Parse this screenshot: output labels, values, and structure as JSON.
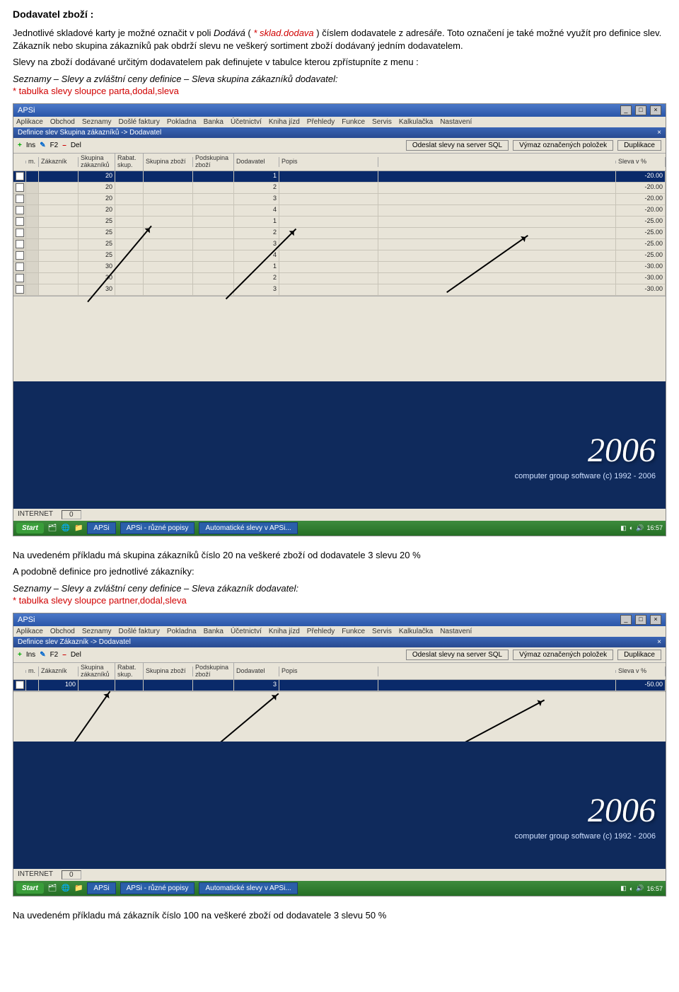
{
  "doc": {
    "heading": "Dodavatel zboží :",
    "p1a": "Jednotlivé skladové karty je možné označit v poli ",
    "p1_field": "Dodává",
    "p1b": " ( ",
    "p1_var": "* sklad.dodava",
    "p1c": ") číslem dodavatele z adresáře. Toto označení je také možné využít pro definice slev. Zákazník nebo skupina zákazníků pak obdrží slevu ne veškerý sortiment zboží dodávaný jedním dodavatelem.",
    "p2": "Slevy na zboží dodávané určitým dodavatelem pak definujete v tabulce kterou zpřístupníte z menu :",
    "p3": "Seznamy – Slevy a zvláštní ceny definice – Sleva  skupina zákazníků  dodavatel:",
    "p3_red": "* tabulka slevy sloupce parta,dodal,sleva",
    "p4": "Na uvedeném příkladu má  skupina zákazníků  číslo 20 na veškeré zboží od dodavatele 3  slevu 20 %",
    "p5": "A podobně definice pro jednotlivé zákazníky:",
    "p6": "Seznamy – Slevy a zvláštní ceny definice – Sleva  zákazník   dodavatel:",
    "p6_red": "* tabulka slevy sloupce partner,dodal,sleva",
    "p7": "Na uvedeném příkladu má  zákazník  číslo 100 na veškeré zboží od dodavatele 3  slevu 50 %"
  },
  "app": {
    "title": "APSi",
    "menubar": [
      "Aplikace",
      "Obchod",
      "Seznamy",
      "Došlé faktury",
      "Pokladna",
      "Banka",
      "Účetnictví",
      "Kniha jízd",
      "Přehledy",
      "Funkce",
      "Servis",
      "Kalkulačka",
      "Nastavení"
    ],
    "subtitle1": "Definice slev Skupina zákazníků -> Dodavatel",
    "subtitle2": "Definice slev Zákazník -> Dodavatel",
    "toolbar": {
      "ins": "Ins",
      "f2": "F2",
      "del": "Del",
      "b1": "Odeslat slevy na server SQL",
      "b2": "Výmaz označených položek",
      "b3": "Duplikace"
    },
    "headers": [
      "",
      "m.",
      "Zákazník",
      "Skupina zákazníků",
      "Rabat. skup.",
      "Skupina zboží",
      "Podskupina zboží",
      "Dodavatel",
      "Popis",
      "",
      "Sleva v %"
    ],
    "rows1": [
      {
        "zak": "",
        "sk": "20",
        "rb": "",
        "sz": "",
        "pz": "",
        "dod": "1",
        "pop": "",
        "sl": "-20.00"
      },
      {
        "zak": "",
        "sk": "20",
        "rb": "",
        "sz": "",
        "pz": "",
        "dod": "2",
        "pop": "",
        "sl": "-20.00"
      },
      {
        "zak": "",
        "sk": "20",
        "rb": "",
        "sz": "",
        "pz": "",
        "dod": "3",
        "pop": "",
        "sl": "-20.00"
      },
      {
        "zak": "",
        "sk": "20",
        "rb": "",
        "sz": "",
        "pz": "",
        "dod": "4",
        "pop": "",
        "sl": "-20.00"
      },
      {
        "zak": "",
        "sk": "25",
        "rb": "",
        "sz": "",
        "pz": "",
        "dod": "1",
        "pop": "",
        "sl": "-25.00"
      },
      {
        "zak": "",
        "sk": "25",
        "rb": "",
        "sz": "",
        "pz": "",
        "dod": "2",
        "pop": "",
        "sl": "-25.00"
      },
      {
        "zak": "",
        "sk": "25",
        "rb": "",
        "sz": "",
        "pz": "",
        "dod": "3",
        "pop": "",
        "sl": "-25.00"
      },
      {
        "zak": "",
        "sk": "25",
        "rb": "",
        "sz": "",
        "pz": "",
        "dod": "4",
        "pop": "",
        "sl": "-25.00"
      },
      {
        "zak": "",
        "sk": "30",
        "rb": "",
        "sz": "",
        "pz": "",
        "dod": "1",
        "pop": "",
        "sl": "-30.00"
      },
      {
        "zak": "",
        "sk": "30",
        "rb": "",
        "sz": "",
        "pz": "",
        "dod": "2",
        "pop": "",
        "sl": "-30.00"
      },
      {
        "zak": "",
        "sk": "30",
        "rb": "",
        "sz": "",
        "pz": "",
        "dod": "3",
        "pop": "",
        "sl": "-30.00"
      }
    ],
    "rows2": [
      {
        "zak": "100",
        "sk": "",
        "rb": "",
        "sz": "",
        "pz": "",
        "dod": "3",
        "pop": "",
        "sl": "-50.00"
      }
    ],
    "brand_year": "2006",
    "brand_sub": "computer group software     (c) 1992 - 2006",
    "status_left": "INTERNET",
    "status_mid": "0",
    "taskbar": {
      "start": "Start",
      "apsi": "APSi",
      "t1": "APSi - různé popisy",
      "t2": "Automatické slevy v APSi...",
      "time": "16:57"
    }
  }
}
